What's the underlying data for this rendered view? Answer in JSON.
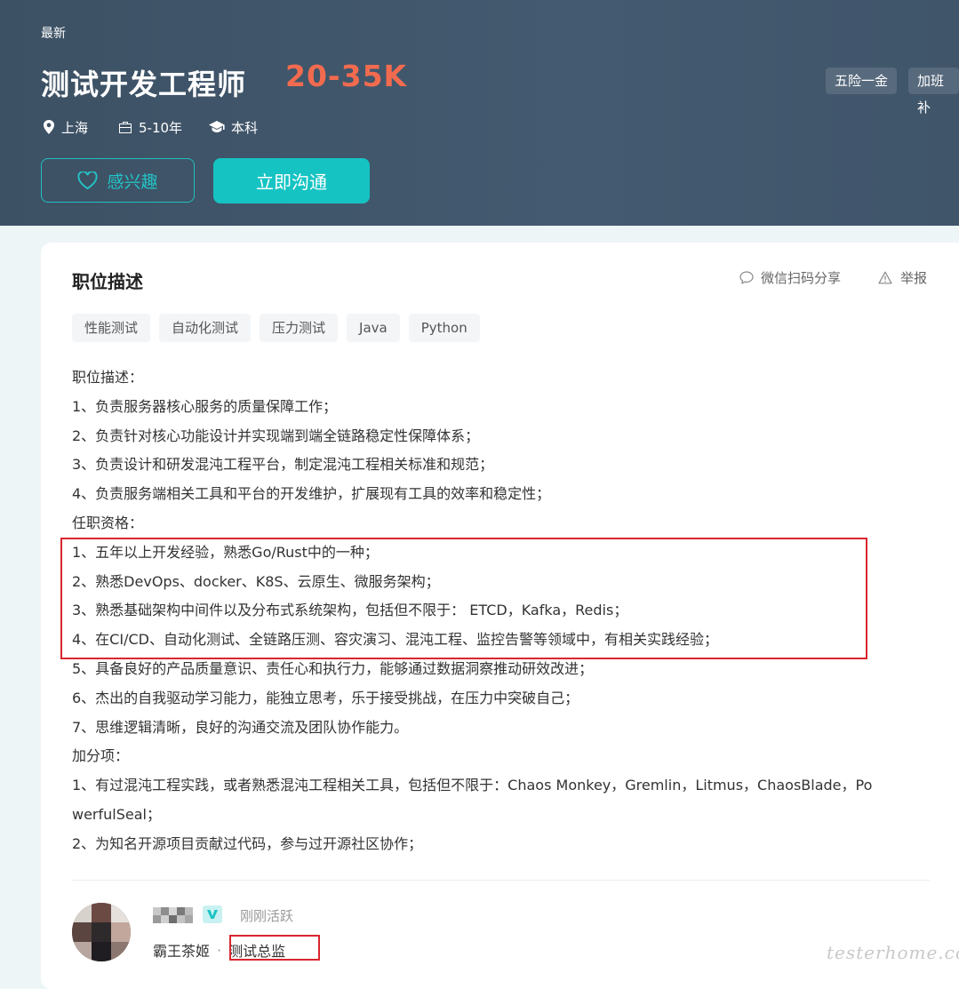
{
  "header": {
    "badge": "最新",
    "title": "测试开发工程师",
    "salary": "20-35K",
    "benefits": [
      "五险一金",
      "加班补"
    ],
    "meta": {
      "city": "上海",
      "experience": "5-10年",
      "education": "本科"
    },
    "interest_button": "感兴趣",
    "chat_button": "立即沟通"
  },
  "card": {
    "section_title": "职位描述",
    "share_label": "微信扫码分享",
    "report_label": "举报",
    "skills": [
      "性能测试",
      "自动化测试",
      "压力测试",
      "Java",
      "Python"
    ],
    "lines": [
      "职位描述：",
      "1、负责服务器核心服务的质量保障工作；",
      "2、负责针对核心功能设计并实现端到端全链路稳定性保障体系；",
      "3、负责设计和研发混沌工程平台，制定混沌工程相关标准和规范；",
      "4、负责服务端相关工具和平台的开发维护，扩展现有工具的效率和稳定性；",
      "任职资格：",
      "1、五年以上开发经验，熟悉Go/Rust中的一种；",
      "2、熟悉DevOps、docker、K8S、云原生、微服务架构；",
      "3、熟悉基础架构中间件以及分布式系统架构，包括但不限于： ETCD，Kafka，Redis；",
      "4、在CI/CD、自动化测试、全链路压测、容灾演习、混沌工程、监控告警等领域中，有相关实践经验；",
      "5、具备良好的产品质量意识、责任心和执行力，能够通过数据洞察推动研效改进；",
      "6、杰出的自我驱动学习能力，能独立思考，乐于接受挑战，在压力中突破自己；",
      "7、思维逻辑清晰，良好的沟通交流及团队协作能力。",
      "加分项：",
      "1、有过混沌工程实践，或者熟悉混沌工程相关工具，包括但不限于：Chaos Monkey，Gremlin，Litmus，ChaosBlade，Po",
      "werfulSeal；",
      "2、为知名开源项目贡献过代码，参与过开源社区协作；"
    ],
    "recruiter": {
      "status": "刚刚活跃",
      "company": "霸王茶姬",
      "separator": "·",
      "role": "测试总监"
    }
  },
  "watermark": "testerhome.com",
  "colors": {
    "salary": "#f26b4f",
    "accent": "#16c3c3",
    "highlight": "#d9262f",
    "header_bg": "#40566b"
  }
}
